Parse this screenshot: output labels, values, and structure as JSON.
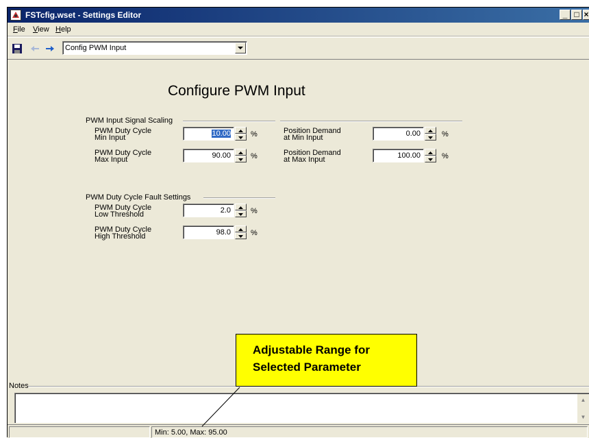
{
  "window": {
    "title": "FSTcfig.wset - Settings Editor",
    "controls": {
      "minimize": "_",
      "maximize": "□",
      "close": "×"
    }
  },
  "menu": {
    "items": [
      "File",
      "View",
      "Help"
    ]
  },
  "toolbar": {
    "icons": [
      "save-icon",
      "back-arrow-icon",
      "forward-arrow-icon"
    ],
    "page_select": "Config PWM Input"
  },
  "page": {
    "title": "Configure PWM Input",
    "groups": {
      "signal_scaling": {
        "label": "PWM Input Signal Scaling",
        "params": [
          {
            "label_line1": "PWM Duty Cycle",
            "label_line2": "Min Input",
            "value": "10.00",
            "unit": "%",
            "selected": true
          },
          {
            "label_line1": "PWM Duty Cycle",
            "label_line2": "Max Input",
            "value": "90.00",
            "unit": "%"
          },
          {
            "label_line1": "Position Demand",
            "label_line2": "at Min Input",
            "value": "0.00",
            "unit": "%"
          },
          {
            "label_line1": "Position Demand",
            "label_line2": "at Max Input",
            "value": "100.00",
            "unit": "%"
          }
        ]
      },
      "fault_settings": {
        "label": "PWM Duty Cycle Fault Settings",
        "params": [
          {
            "label_line1": "PWM Duty Cycle",
            "label_line2": "Low Threshold",
            "value": "2.0",
            "unit": "%"
          },
          {
            "label_line1": "PWM Duty Cycle",
            "label_line2": "High Threshold",
            "value": "98.0",
            "unit": "%"
          }
        ]
      }
    }
  },
  "notes": {
    "label": "Notes",
    "value": ""
  },
  "status": {
    "range": "Min: 5.00, Max: 95.00"
  },
  "callout": {
    "line1": "Adjustable Range for",
    "line2": "Selected Parameter",
    "color": "#ffff00"
  },
  "colors": {
    "titlebar": "#0a246a",
    "face": "#ece9d8",
    "selection": "#316ac5"
  }
}
